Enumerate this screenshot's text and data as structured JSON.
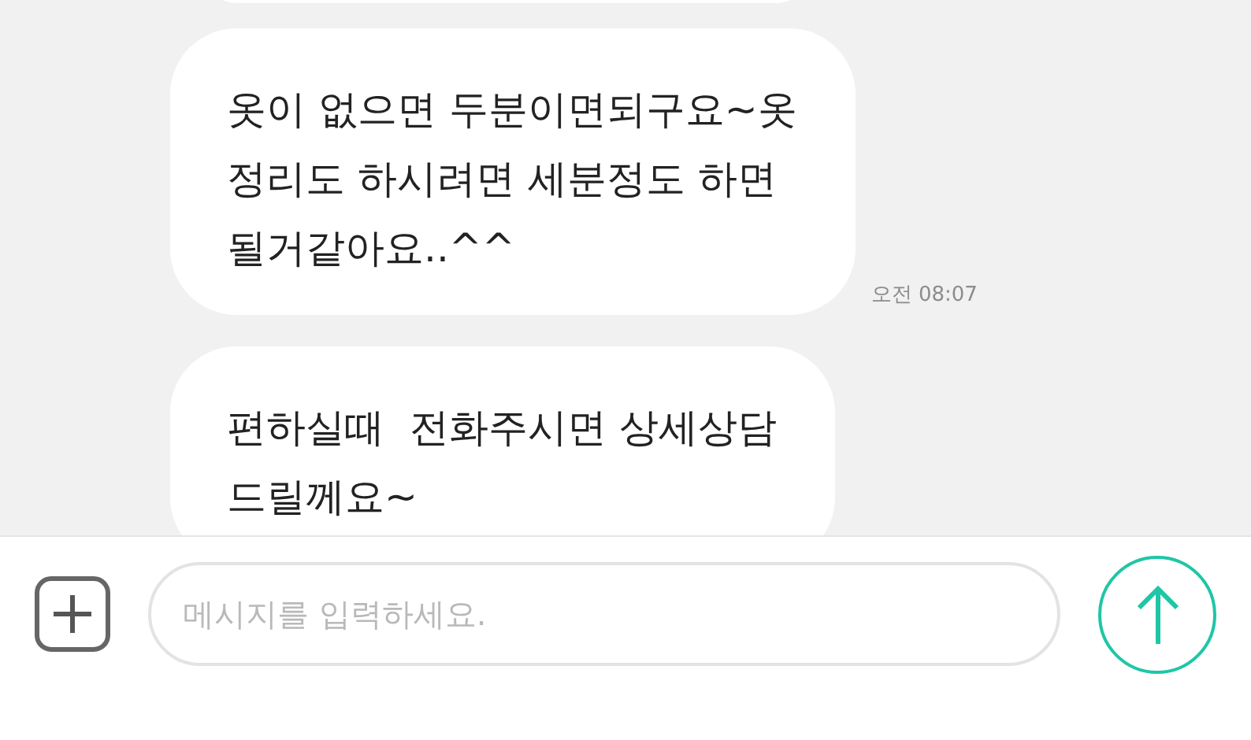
{
  "messages": [
    {
      "text": "옷이 없으면 두분이면되구요~옷\n정리도 하시려면 세분정도 하면\n될거같아요..^^",
      "time": "오전 08:07"
    },
    {
      "text": "편하실때  전화주시면 상세상담\n드릴께요~"
    }
  ],
  "composer": {
    "placeholder": "메시지를 입력하세요."
  }
}
